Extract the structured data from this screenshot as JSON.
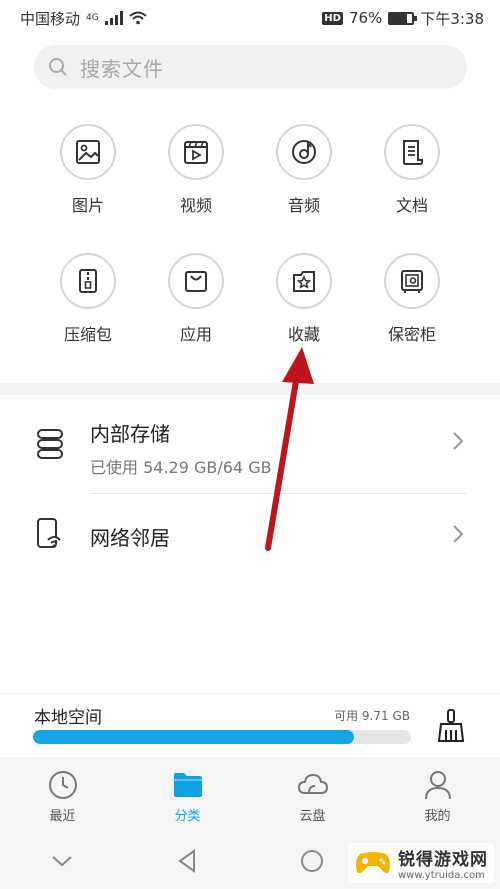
{
  "status_bar": {
    "carrier": "中国移动",
    "network": "4G",
    "battery": "76%",
    "battery_level": 0.76,
    "time": "下午3:38"
  },
  "search": {
    "placeholder": "搜索文件"
  },
  "categories": [
    {
      "label": "图片",
      "icon": "image-icon"
    },
    {
      "label": "视频",
      "icon": "video-icon"
    },
    {
      "label": "音频",
      "icon": "audio-icon"
    },
    {
      "label": "文档",
      "icon": "document-icon"
    },
    {
      "label": "压缩包",
      "icon": "archive-icon"
    },
    {
      "label": "应用",
      "icon": "app-bag-icon"
    },
    {
      "label": "收藏",
      "icon": "favorites-star-icon"
    },
    {
      "label": "保密柜",
      "icon": "safe-icon"
    }
  ],
  "storage_rows": [
    {
      "title": "内部存储",
      "subtitle": "已使用 54.29 GB/64 GB",
      "icon": "storage-stack-icon"
    },
    {
      "title": "网络邻居",
      "icon": "network-phone-icon"
    }
  ],
  "local_space": {
    "title": "本地空间",
    "available": "可用 9.71 GB",
    "used_fraction": 0.85,
    "bar_color": "#14a6e8"
  },
  "bottom_nav": [
    {
      "label": "最近",
      "icon": "clock-icon",
      "active": false
    },
    {
      "label": "分类",
      "icon": "folder-icon",
      "active": true
    },
    {
      "label": "云盘",
      "icon": "cloud-icon",
      "active": false
    },
    {
      "label": "我的",
      "icon": "person-icon",
      "active": false
    }
  ],
  "accent_color": "#11a2e6",
  "annotation_color": "#c0141c",
  "watermark": {
    "name": "锐得游戏网",
    "url": "www.ytruida.com"
  }
}
